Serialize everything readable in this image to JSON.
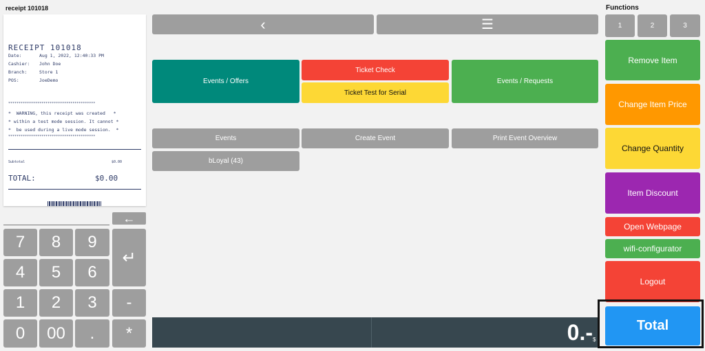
{
  "header": {
    "receipt_label": "receipt 101018",
    "functions_label": "Functions"
  },
  "receipt": {
    "title": "RECEIPT 101018",
    "date_key": "Date:",
    "date_val": "Aug 1, 2022, 12:40:33 PM",
    "cashier_key": "Cashier:",
    "cashier_val": "John Doe",
    "branch_key": "Branch:",
    "branch_val": "Store 1",
    "pos_key": "POS:",
    "pos_val": "JoeDemo",
    "stars": "******************************************",
    "warn1": "*  WARNING, this receipt was created   *",
    "warn2": "* within a test mode session. It cannot *",
    "warn3": "*  be used during a live mode session.  *",
    "subtotal_label": "Subtotal",
    "subtotal_value": "$0.00",
    "total_label": "TOTAL:",
    "total_value": "$0.00"
  },
  "numpad": {
    "backspace": "←",
    "enter": "↵",
    "keys": [
      "7",
      "8",
      "9",
      "4",
      "5",
      "6",
      "1",
      "2",
      "3",
      "-",
      "0",
      "00",
      ".",
      "*"
    ]
  },
  "nav": {
    "back": "‹",
    "menu": "☰"
  },
  "grid": {
    "events_offers": "Events / Offers",
    "ticket_check": "Ticket Check",
    "ticket_test": "Ticket Test for Serial",
    "events_requests": "Events / Requests",
    "events": "Events",
    "create_event": "Create Event",
    "print_overview": "Print Event Overview",
    "bloyal": "bLoyal (43)"
  },
  "functions": {
    "pages": [
      "1",
      "2",
      "3"
    ],
    "remove_item": "Remove Item",
    "change_price": "Change Item Price",
    "change_quantity": "Change Quantity",
    "item_discount": "Item Discount",
    "open_webpage": "Open Webpage",
    "wifi": "wifi-configurator",
    "logout": "Logout",
    "total": "Total"
  },
  "footer": {
    "amount": "0.-",
    "currency": "$"
  }
}
